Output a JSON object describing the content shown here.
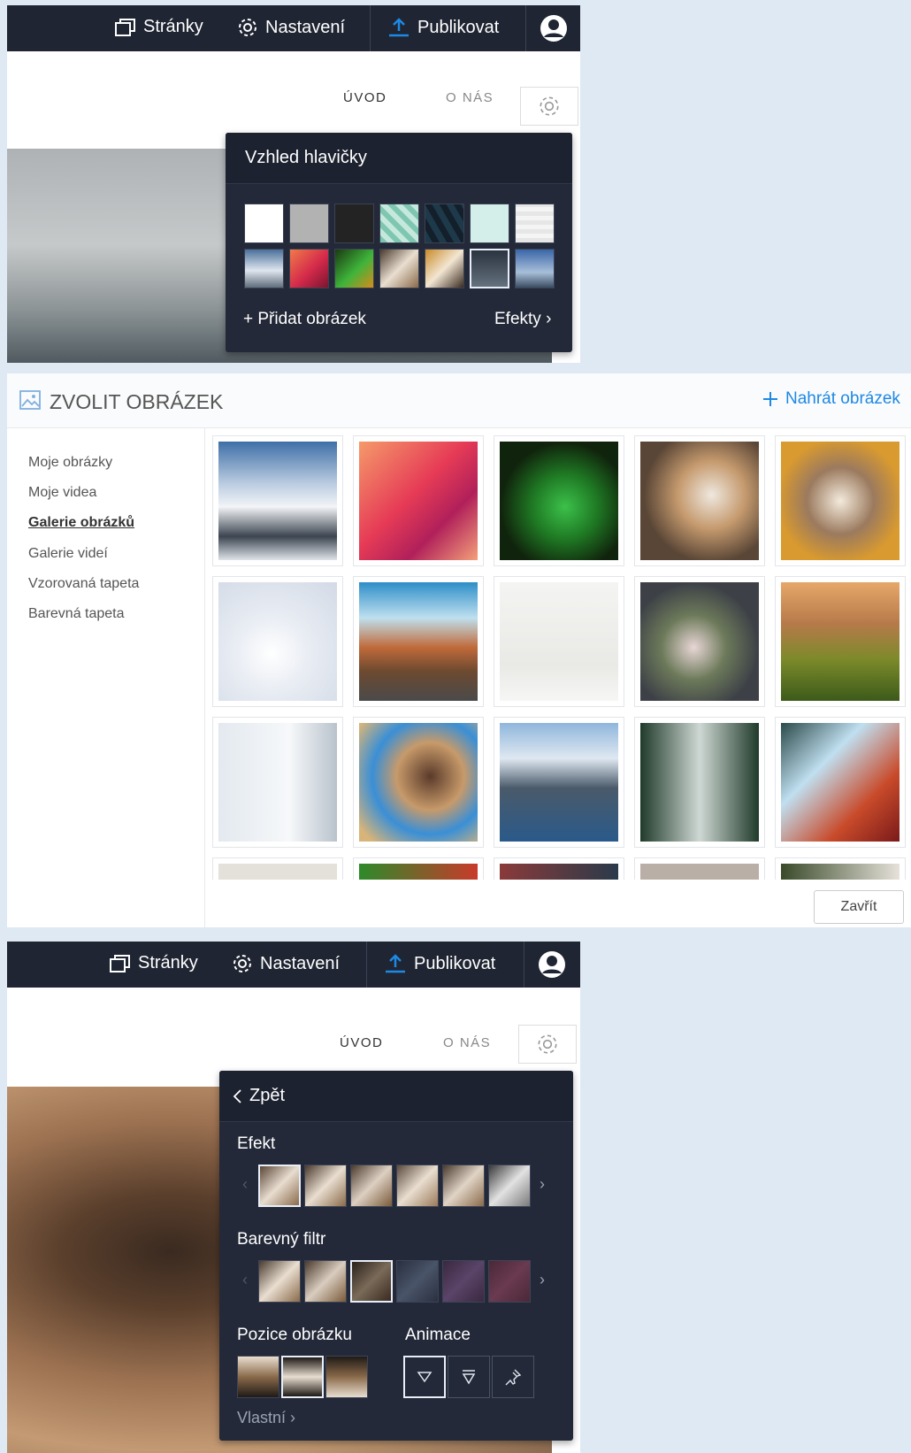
{
  "topbar": {
    "pages_label": "Stránky",
    "settings_label": "Nastavení",
    "publish_label": "Publikovat"
  },
  "site_nav": {
    "items": [
      "ÚVOD",
      "O NÁS"
    ]
  },
  "header_popup": {
    "title": "Vzhled hlavičky",
    "add_image": "+ Přidat obrázek",
    "effects": "Efekty ›"
  },
  "picker": {
    "title": "ZVOLIT OBRÁZEK",
    "upload": "Nahrát obrázek",
    "sidebar": [
      "Moje obrázky",
      "Moje videa",
      "Galerie obrázků",
      "Galerie videí",
      "Vzorovaná tapeta",
      "Barevná tapeta"
    ],
    "active_index": 2,
    "close": "Zavřít"
  },
  "effects_popup": {
    "back": "Zpět",
    "effect_label": "Efekt",
    "filter_label": "Barevný filtr",
    "position_label": "Pozice obrázku",
    "animation_label": "Animace",
    "custom": "Vlastní ›"
  },
  "icons": {
    "pages": "pages-icon",
    "settings": "gear-icon",
    "publish": "upload-icon",
    "account": "user-icon",
    "image": "image-icon",
    "plus": "plus-icon",
    "back": "chevron-left-icon"
  },
  "colors": {
    "topbar": "#1f2532",
    "popup": "#232938",
    "accent": "#1e88e5",
    "page_bg": "#dfe9f4"
  }
}
